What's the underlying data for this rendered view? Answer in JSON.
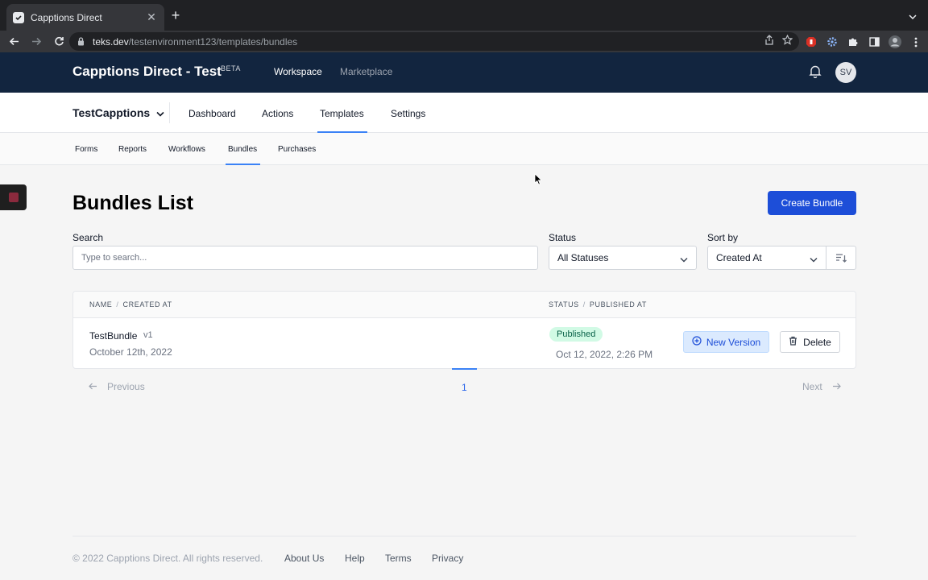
{
  "browser": {
    "tab_title": "Capptions Direct",
    "url_host": "teks.dev",
    "url_path": "/testenvironment123/templates/bundles"
  },
  "header": {
    "brand": "Capptions Direct - Test",
    "badge": "BETA",
    "nav": [
      {
        "label": "Workspace",
        "active": true
      },
      {
        "label": "Marketplace",
        "active": false
      }
    ],
    "avatar_initials": "SV"
  },
  "secondary_nav": {
    "workspace_name": "TestCapptions",
    "items": [
      "Dashboard",
      "Actions",
      "Templates",
      "Settings"
    ],
    "active": "Templates"
  },
  "sub_nav": {
    "items": [
      "Forms",
      "Reports",
      "Workflows",
      "Bundles",
      "Purchases"
    ],
    "active": "Bundles"
  },
  "main": {
    "title": "Bundles List",
    "create_button": "Create Bundle",
    "search_label": "Search",
    "search_placeholder": "Type to search...",
    "status_label": "Status",
    "status_value": "All Statuses",
    "sort_label": "Sort by",
    "sort_value": "Created At"
  },
  "table": {
    "col1": "NAME",
    "col1b": "CREATED AT",
    "col2": "STATUS",
    "col2b": "PUBLISHED AT",
    "rows": [
      {
        "name": "TestBundle",
        "version": "v1",
        "created": "October 12th, 2022",
        "status": "Published",
        "published_at": "Oct 12, 2022, 2:26 PM",
        "new_version_label": "New Version",
        "delete_label": "Delete"
      }
    ]
  },
  "pagination": {
    "prev": "Previous",
    "page": "1",
    "next": "Next"
  },
  "footer": {
    "copyright": "© 2022 Capptions Direct. All rights reserved.",
    "links": [
      "About Us",
      "Help",
      "Terms",
      "Privacy"
    ]
  },
  "colors": {
    "appbar": "#12253f",
    "primary": "#1d4ed8",
    "badge_bg": "#d1fae5",
    "badge_text": "#065f46"
  }
}
